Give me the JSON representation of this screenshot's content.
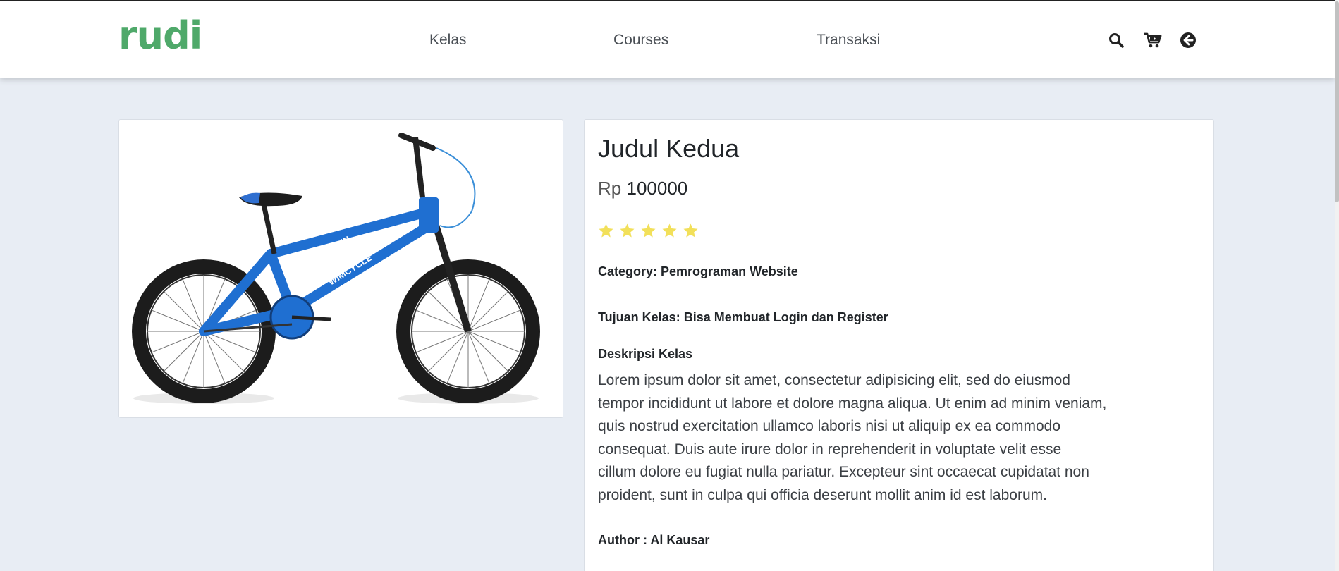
{
  "brand": "rudi",
  "nav": {
    "links": [
      "Kelas",
      "Courses",
      "Transaksi"
    ]
  },
  "icons": {
    "search": "search-icon",
    "cart": "cart-icon",
    "back": "arrow-left-circle-icon"
  },
  "colors": {
    "brand": "#4fa96a",
    "star": "#f2e05a",
    "background": "#e8edf4"
  },
  "product": {
    "image_alt": "bmx-bike-image",
    "title": "Judul Kedua",
    "currency": "Rp",
    "price": "100000",
    "rating": 5,
    "category_label": "Category:",
    "category_value": "Pemrograman Website",
    "goal_label": "Tujuan Kelas:",
    "goal_value": "Bisa Membuat Login dan Register",
    "description_heading": "Deskripsi Kelas",
    "description_lines": [
      "Lorem ipsum dolor sit amet, consectetur adipisicing elit, sed do eiusmod",
      "tempor incididunt ut labore et dolore magna aliqua. Ut enim ad minim veniam,",
      "quis nostrud exercitation ullamco laboris nisi ut aliquip ex ea commodo",
      "consequat. Duis aute irure dolor in reprehenderit in voluptate velit esse",
      "cillum dolore eu fugiat nulla pariatur. Excepteur sint occaecat cupidatat non",
      "proident, sunt in culpa qui officia deserunt mollit anim id est laborum."
    ],
    "author_label": "Author :",
    "author_value": "Al Kausar"
  }
}
